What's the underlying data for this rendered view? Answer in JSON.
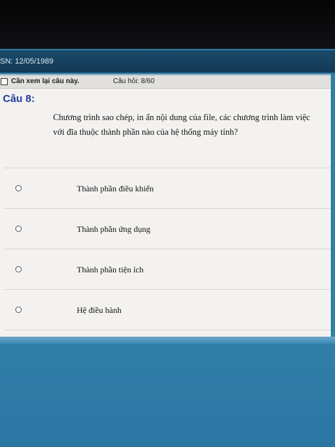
{
  "header": {
    "dob": "SN: 12/05/1989"
  },
  "review_bar": {
    "label": "Cần xem lại câu này.",
    "counter": "Câu hỏi: 8/60"
  },
  "question": {
    "title": "Câu 8:",
    "text": "Chương trình sao chép, in ấn nội dung của file, các chương trình làm việc với đĩa thuộc thành phần nào của hệ thống máy tính?"
  },
  "options": [
    {
      "label": "Thành phần điều khiển"
    },
    {
      "label": "Thành phần ứng dụng"
    },
    {
      "label": "Thành phần tiện ích"
    },
    {
      "label": "Hệ điều hành"
    }
  ],
  "colors": {
    "title": "#1f3fa0",
    "screen_bg": "#2f7fa8",
    "panel_bg": "#f3f2f0"
  }
}
